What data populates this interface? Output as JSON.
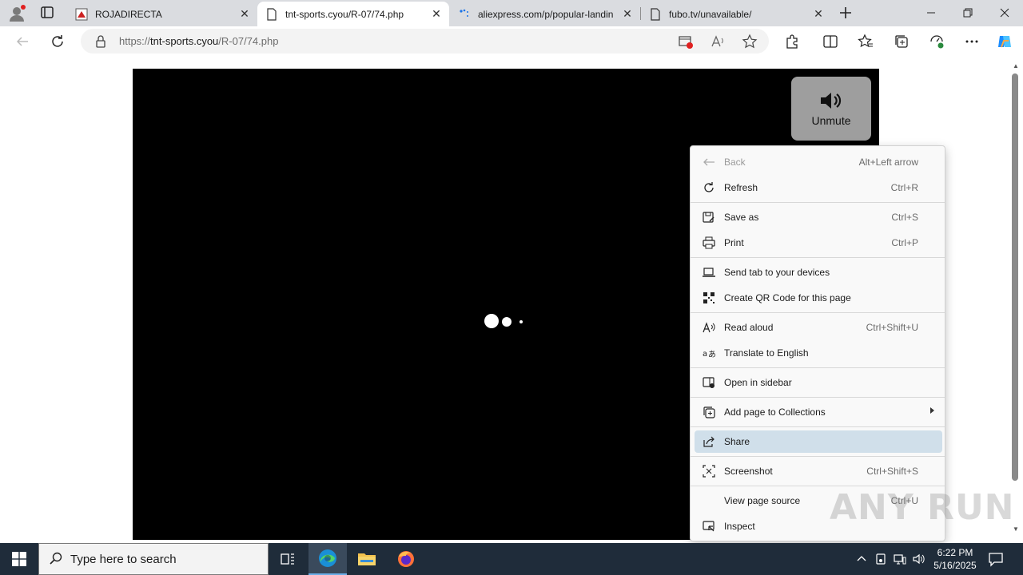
{
  "browser": {
    "tabs": [
      {
        "title": "ROJADIRECTA",
        "favicon": "rojadirecta-favicon",
        "active": false
      },
      {
        "title": "tnt-sports.cyou/R-07/74.php",
        "favicon": "page-icon",
        "active": true
      },
      {
        "title": "aliexpress.com/p/popular-landin",
        "favicon": "loading-icon",
        "active": false
      },
      {
        "title": "fubo.tv/unavailable/",
        "favicon": "page-icon",
        "active": false
      }
    ],
    "address": {
      "scheme": "https://",
      "domain": "tnt-sports.cyou",
      "path": "/R-07/74.php"
    }
  },
  "page": {
    "unmute_label": "Unmute"
  },
  "context_menu": {
    "items": [
      {
        "label": "Back",
        "shortcut": "Alt+Left arrow",
        "icon": "back-arrow-icon",
        "disabled": true
      },
      {
        "label": "Refresh",
        "shortcut": "Ctrl+R",
        "icon": "refresh-icon"
      },
      {
        "label": "Save as",
        "shortcut": "Ctrl+S",
        "icon": "save-as-icon"
      },
      {
        "label": "Print",
        "shortcut": "Ctrl+P",
        "icon": "print-icon"
      },
      {
        "label": "Send tab to your devices",
        "shortcut": "",
        "icon": "send-tab-icon"
      },
      {
        "label": "Create QR Code for this page",
        "shortcut": "",
        "icon": "qr-code-icon"
      },
      {
        "label": "Read aloud",
        "shortcut": "Ctrl+Shift+U",
        "icon": "read-aloud-icon"
      },
      {
        "label": "Translate to English",
        "shortcut": "",
        "icon": "translate-icon"
      },
      {
        "label": "Open in sidebar",
        "shortcut": "",
        "icon": "sidebar-icon"
      },
      {
        "label": "Add page to Collections",
        "shortcut": "",
        "icon": "collections-icon",
        "submenu": true
      },
      {
        "label": "Share",
        "shortcut": "",
        "icon": "share-icon",
        "highlighted": true
      },
      {
        "label": "Screenshot",
        "shortcut": "Ctrl+Shift+S",
        "icon": "screenshot-icon"
      },
      {
        "label": "View page source",
        "shortcut": "Ctrl+U",
        "icon": ""
      },
      {
        "label": "Inspect",
        "shortcut": "",
        "icon": "inspect-icon"
      }
    ]
  },
  "watermark": "ANY RUN",
  "taskbar": {
    "search_placeholder": "Type here to search",
    "time": "6:22 PM",
    "date": "5/16/2025"
  },
  "colors": {
    "taskbar": "#1f2c3a",
    "highlight": "#d0dfea",
    "tabstrip": "#dadce0"
  }
}
